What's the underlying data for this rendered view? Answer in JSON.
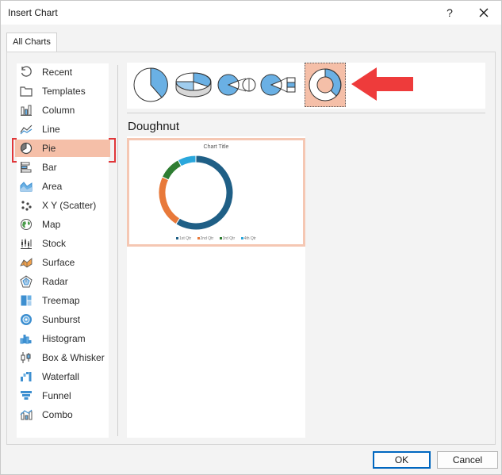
{
  "dialog": {
    "title": "Insert Chart",
    "help_label": "?"
  },
  "tabs": [
    {
      "label": "All Charts"
    }
  ],
  "sidebar": {
    "selected": "Pie",
    "items": [
      {
        "label": "Recent",
        "icon": "recent-icon"
      },
      {
        "label": "Templates",
        "icon": "templates-icon"
      },
      {
        "label": "Column",
        "icon": "column-chart-icon"
      },
      {
        "label": "Line",
        "icon": "line-chart-icon"
      },
      {
        "label": "Pie",
        "icon": "pie-chart-icon"
      },
      {
        "label": "Bar",
        "icon": "bar-chart-icon"
      },
      {
        "label": "Area",
        "icon": "area-chart-icon"
      },
      {
        "label": "X Y (Scatter)",
        "icon": "scatter-chart-icon"
      },
      {
        "label": "Map",
        "icon": "map-chart-icon"
      },
      {
        "label": "Stock",
        "icon": "stock-chart-icon"
      },
      {
        "label": "Surface",
        "icon": "surface-chart-icon"
      },
      {
        "label": "Radar",
        "icon": "radar-chart-icon"
      },
      {
        "label": "Treemap",
        "icon": "treemap-chart-icon"
      },
      {
        "label": "Sunburst",
        "icon": "sunburst-chart-icon"
      },
      {
        "label": "Histogram",
        "icon": "histogram-chart-icon"
      },
      {
        "label": "Box & Whisker",
        "icon": "box-whisker-chart-icon"
      },
      {
        "label": "Waterfall",
        "icon": "waterfall-chart-icon"
      },
      {
        "label": "Funnel",
        "icon": "funnel-chart-icon"
      },
      {
        "label": "Combo",
        "icon": "combo-chart-icon"
      }
    ]
  },
  "subtypes": {
    "selected": "Doughnut",
    "items": [
      {
        "name": "Pie",
        "icon": "pie-subtype-icon"
      },
      {
        "name": "3-D Pie",
        "icon": "pie-3d-subtype-icon"
      },
      {
        "name": "Pie of Pie",
        "icon": "pie-of-pie-subtype-icon"
      },
      {
        "name": "Bar of Pie",
        "icon": "bar-of-pie-subtype-icon"
      },
      {
        "name": "Doughnut",
        "icon": "doughnut-subtype-icon"
      }
    ]
  },
  "preview": {
    "type_name": "Doughnut",
    "chart_title": "Chart Title",
    "legend": [
      {
        "label": "1st Qtr",
        "color": "#1f5f86"
      },
      {
        "label": "2nd Qtr",
        "color": "#e8793a"
      },
      {
        "label": "3rd Qtr",
        "color": "#2e7d32"
      },
      {
        "label": "4th Qtr",
        "color": "#2aa7dc"
      }
    ]
  },
  "chart_data": {
    "type": "pie",
    "title": "Chart Title",
    "categories": [
      "1st Qtr",
      "2nd Qtr",
      "3rd Qtr",
      "4th Qtr"
    ],
    "values": [
      59,
      23,
      10,
      8
    ],
    "colors": [
      "#1f5f86",
      "#e8793a",
      "#2e7d32",
      "#2aa7dc"
    ],
    "legend_position": "bottom"
  },
  "buttons": {
    "ok": "OK",
    "cancel": "Cancel"
  },
  "colors": {
    "accent": "#0067c0",
    "selection": "#f5bfa8",
    "highlight_border": "#e0373a",
    "arrow": "#ee3b3b"
  }
}
